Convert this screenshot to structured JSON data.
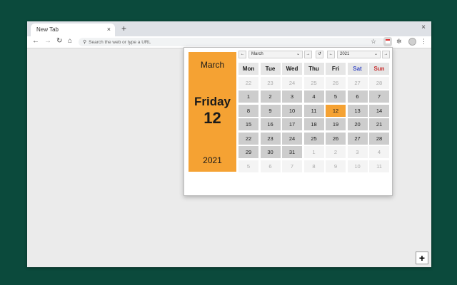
{
  "browser": {
    "tab_title": "New Tab",
    "tab_close": "×",
    "new_tab": "+",
    "window_close": "×",
    "nav_back": "←",
    "nav_forward": "→",
    "nav_reload": "↻",
    "nav_home": "⌂",
    "search_glyph": "⚲",
    "omnibox_placeholder": "Search the web or type a URL",
    "star": "☆",
    "puzzle": "✲",
    "menu": "⋮"
  },
  "page": {
    "corner_button": "+"
  },
  "calendar": {
    "selected": {
      "month": "March",
      "weekday": "Friday",
      "date": "12",
      "year": "2021"
    },
    "controls": {
      "prev_month": "←",
      "month_value": "March",
      "next_month": "→",
      "reset": "↺",
      "prev_year": "←",
      "year_value": "2021",
      "next_year": "→",
      "caret": "⌄"
    },
    "weekdays": [
      "Mon",
      "Tue",
      "Wed",
      "Thu",
      "Fri",
      "Sat",
      "Sun"
    ],
    "weeks": [
      [
        {
          "d": "22",
          "o": true
        },
        {
          "d": "23",
          "o": true
        },
        {
          "d": "24",
          "o": true
        },
        {
          "d": "25",
          "o": true
        },
        {
          "d": "26",
          "o": true
        },
        {
          "d": "27",
          "o": true
        },
        {
          "d": "28",
          "o": true
        }
      ],
      [
        {
          "d": "1",
          "o": false
        },
        {
          "d": "2",
          "o": false
        },
        {
          "d": "3",
          "o": false
        },
        {
          "d": "4",
          "o": false
        },
        {
          "d": "5",
          "o": false
        },
        {
          "d": "6",
          "o": false
        },
        {
          "d": "7",
          "o": false
        }
      ],
      [
        {
          "d": "8",
          "o": false
        },
        {
          "d": "9",
          "o": false
        },
        {
          "d": "10",
          "o": false
        },
        {
          "d": "11",
          "o": false
        },
        {
          "d": "12",
          "o": false,
          "today": true
        },
        {
          "d": "13",
          "o": false
        },
        {
          "d": "14",
          "o": false
        }
      ],
      [
        {
          "d": "15",
          "o": false
        },
        {
          "d": "16",
          "o": false
        },
        {
          "d": "17",
          "o": false
        },
        {
          "d": "18",
          "o": false
        },
        {
          "d": "19",
          "o": false
        },
        {
          "d": "20",
          "o": false
        },
        {
          "d": "21",
          "o": false
        }
      ],
      [
        {
          "d": "22",
          "o": false
        },
        {
          "d": "23",
          "o": false
        },
        {
          "d": "24",
          "o": false
        },
        {
          "d": "25",
          "o": false
        },
        {
          "d": "26",
          "o": false
        },
        {
          "d": "27",
          "o": false
        },
        {
          "d": "28",
          "o": false
        }
      ],
      [
        {
          "d": "29",
          "o": false
        },
        {
          "d": "30",
          "o": false
        },
        {
          "d": "31",
          "o": false
        },
        {
          "d": "1",
          "o": true
        },
        {
          "d": "2",
          "o": true
        },
        {
          "d": "3",
          "o": true
        },
        {
          "d": "4",
          "o": true
        }
      ],
      [
        {
          "d": "5",
          "o": true
        },
        {
          "d": "6",
          "o": true
        },
        {
          "d": "7",
          "o": true
        },
        {
          "d": "8",
          "o": true
        },
        {
          "d": "9",
          "o": true
        },
        {
          "d": "10",
          "o": true
        },
        {
          "d": "11",
          "o": true
        }
      ]
    ],
    "colors": {
      "accent": "#f5a233",
      "saturday": "#3a4cc5",
      "sunday": "#c83030"
    }
  }
}
